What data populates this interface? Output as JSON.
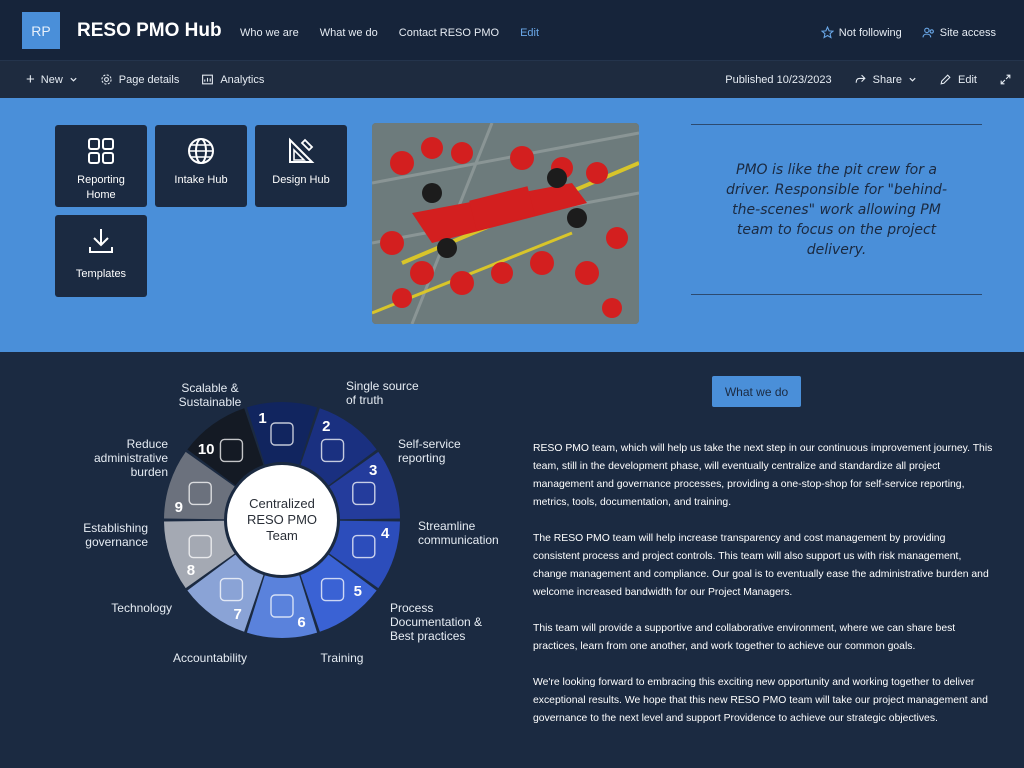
{
  "site": {
    "logo_initials": "RP",
    "title": "RESO PMO Hub",
    "nav": [
      "Who we are",
      "What we do",
      "Contact RESO PMO",
      "Edit"
    ],
    "follow_label": "Not following",
    "access_label": "Site access"
  },
  "cmdbar": {
    "new_label": "New",
    "page_details_label": "Page details",
    "analytics_label": "Analytics",
    "published_label": "Published 10/23/2023",
    "share_label": "Share",
    "edit_label": "Edit"
  },
  "tiles": [
    {
      "label": "Reporting Home",
      "icon": "grid-icon"
    },
    {
      "label": "Intake Hub",
      "icon": "globe-icon"
    },
    {
      "label": "Design Hub",
      "icon": "design-ruler-icon"
    },
    {
      "label": "Templates",
      "icon": "download-icon"
    }
  ],
  "quote": "PMO is like the pit crew for a driver. Responsible for \"behind-the-scenes\" work allowing PM team to focus on the project delivery.",
  "wheel": {
    "center": [
      "Centralized",
      "RESO PMO",
      "Team"
    ],
    "segments": [
      {
        "num": "1",
        "label": [
          "Single source",
          "of truth"
        ],
        "color": "#11255f"
      },
      {
        "num": "2",
        "label": [
          "Self-service",
          "reporting"
        ],
        "color": "#1a3080"
      },
      {
        "num": "3",
        "label": [
          "Streamline",
          "communication"
        ],
        "color": "#243c9c"
      },
      {
        "num": "4",
        "label": [
          "Process",
          "Documentation &",
          "Best practices"
        ],
        "color": "#2c4dbb"
      },
      {
        "num": "5",
        "label": [
          "Training"
        ],
        "color": "#3a62d4"
      },
      {
        "num": "6",
        "label": [
          "Accountability"
        ],
        "color": "#5a82dc"
      },
      {
        "num": "7",
        "label": [
          "Technology"
        ],
        "color": "#8aa3d6"
      },
      {
        "num": "8",
        "label": [
          "Establishing",
          "governance"
        ],
        "color": "#a4a9b3"
      },
      {
        "num": "9",
        "label": [
          "Reduce",
          "administrative",
          "burden"
        ],
        "color": "#6b717d"
      },
      {
        "num": "10",
        "label": [
          "Scalable &",
          "Sustainable"
        ],
        "color": "#141a24"
      }
    ]
  },
  "what_we_do_label": "What we do",
  "paragraphs": [
    "RESO PMO team, which will help us take the next step in our continuous improvement journey. This team, still in the development phase, will eventually centralize and standardize all project management and governance processes, providing a one-stop-shop for self-service reporting, metrics, tools, documentation, and training.",
    "The RESO PMO team will help increase transparency and cost management by providing consistent process and project controls. This team will also support us with risk management, change management and compliance. Our goal is to eventually ease the administrative burden and welcome increased bandwidth for our Project Managers.",
    "This team will provide a supportive and collaborative environment, where we can share best practices, learn from one another, and work together to achieve our common goals.",
    "We're looking forward to embracing this exciting new opportunity and working together to deliver exceptional results. We hope that this new RESO PMO team will take our project management and governance to the next level and support Providence to achieve our strategic objectives."
  ]
}
